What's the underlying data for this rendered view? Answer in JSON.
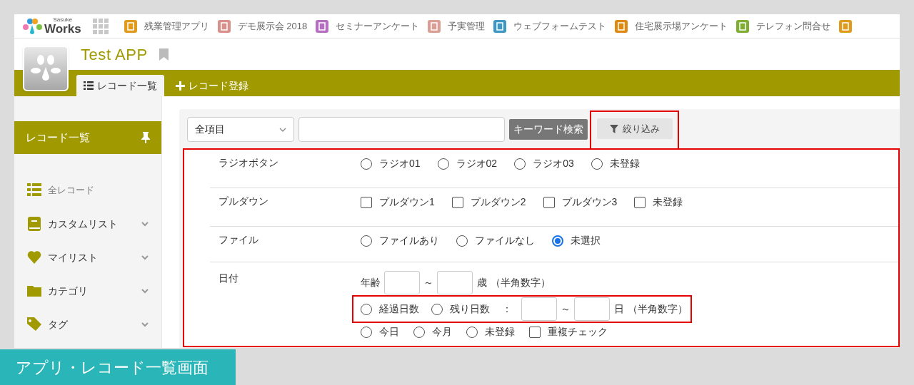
{
  "app_bar": {
    "logo_small": "Sasuke",
    "logo": "Works",
    "apps": [
      {
        "label": "残業管理アプリ",
        "color": "#e09a1c"
      },
      {
        "label": "デモ展示会 2018",
        "color": "#d98f8a"
      },
      {
        "label": "セミナーアンケート",
        "color": "#b46fc0"
      },
      {
        "label": "予実管理",
        "color": "#dc9e94"
      },
      {
        "label": "ウェブフォームテスト",
        "color": "#3f97c4"
      },
      {
        "label": "住宅展示場アンケート",
        "color": "#de8a10"
      },
      {
        "label": "テレフォン問合せ",
        "color": "#7fae33"
      },
      {
        "color": "#e09a1c"
      }
    ]
  },
  "header": {
    "title": "Test APP",
    "tabs": [
      {
        "label": "レコード一覧",
        "kind": "list",
        "selected": true
      },
      {
        "label": "レコード登録",
        "kind": "add",
        "selected": false
      }
    ]
  },
  "sidebar": {
    "title": "レコード一覧",
    "items": [
      {
        "label": "全レコード",
        "kind": "list",
        "expandable": false
      },
      {
        "label": "カスタムリスト",
        "kind": "book",
        "expandable": true
      },
      {
        "label": "マイリスト",
        "kind": "heart",
        "expandable": true
      },
      {
        "label": "カテゴリ",
        "kind": "folder",
        "expandable": true
      },
      {
        "label": "タグ",
        "kind": "tag",
        "expandable": true
      }
    ]
  },
  "search": {
    "field_select": "全項目",
    "keyword_button": "キーワード検索",
    "filter_button": "絞り込み"
  },
  "filters": [
    {
      "label": "ラジオボタン",
      "kind": "radio",
      "options": [
        {
          "label": "ラジオ01",
          "selected": false
        },
        {
          "label": "ラジオ02",
          "selected": false
        },
        {
          "label": "ラジオ03",
          "selected": false
        },
        {
          "label": "未登録",
          "selected": false
        }
      ]
    },
    {
      "label": "プルダウン",
      "kind": "checkbox",
      "options": [
        {
          "label": "プルダウン1",
          "selected": false
        },
        {
          "label": "プルダウン2",
          "selected": false
        },
        {
          "label": "プルダウン3",
          "selected": false
        },
        {
          "label": "未登録",
          "selected": false
        }
      ]
    },
    {
      "label": "ファイル",
      "kind": "radio",
      "options": [
        {
          "label": "ファイルあり",
          "selected": false
        },
        {
          "label": "ファイルなし",
          "selected": false
        },
        {
          "label": "未選択",
          "selected": true
        }
      ]
    },
    {
      "label": "日付",
      "kind": "date",
      "age_label": "年齢",
      "age_tilde": "～",
      "age_unit": "歳",
      "age_note": "（半角数字）",
      "day_modes": [
        {
          "label": "経過日数",
          "selected": false
        },
        {
          "label": "残り日数",
          "selected": false
        }
      ],
      "colon": "：",
      "day_tilde": "～",
      "day_unit": "日",
      "day_note": "（半角数字）",
      "extras": [
        {
          "kind": "radio",
          "label": "今日",
          "selected": false
        },
        {
          "kind": "radio",
          "label": "今月",
          "selected": false
        },
        {
          "kind": "radio",
          "label": "未登録",
          "selected": false
        },
        {
          "kind": "checkbox",
          "label": "重複チェック",
          "selected": false
        }
      ]
    }
  ],
  "caption": "アプリ・レコード一覧画面"
}
